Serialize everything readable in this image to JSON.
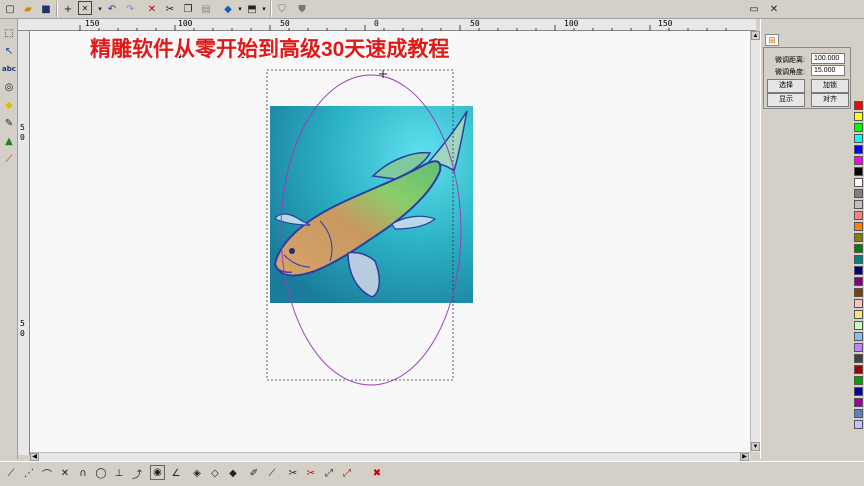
{
  "overlay_title": "精雕软件从零开始到高级30天速成教程",
  "ruler": {
    "h_labels": [
      "150",
      "100",
      "50",
      "0",
      "50",
      "100",
      "150"
    ],
    "v_labels": [
      "5",
      "0",
      "5",
      "0"
    ]
  },
  "toolbar_top": {
    "icons": [
      "new-file-icon",
      "open-folder-icon",
      "save-icon",
      "crosshair-icon",
      "snap-grid-icon",
      "undo-icon",
      "redo-icon",
      "delete-icon",
      "cut-icon",
      "copy-icon",
      "paste-icon",
      "layer-color-icon",
      "view-3d-icon",
      "display-icon",
      "shield-icon"
    ]
  },
  "left_tools": [
    "select-rect-tool-icon",
    "node-edit-tool-icon",
    "text-tool-icon",
    "transform-tool-icon",
    "fill-tool-icon",
    "pen-tool-icon",
    "tree-tool-icon",
    "measure-tool-icon"
  ],
  "right_panel": {
    "tab_icon": "grid-tab-icon",
    "fine_distance_label": "微调距离:",
    "fine_distance_value": "100.000",
    "fine_angle_label": "微调角度:",
    "fine_angle_value": "15.000",
    "btn_select": "选择",
    "btn_process": "加锁",
    "btn_display": "显示",
    "btn_align": "对齐"
  },
  "palette_colors": [
    "#ff0000",
    "#ffff00",
    "#00ff00",
    "#00ffff",
    "#0000ff",
    "#ff00ff",
    "#000000",
    "#ffffff",
    "#808080",
    "#c0c0c0",
    "#ff8080",
    "#ff8000",
    "#808000",
    "#008000",
    "#008080",
    "#000080",
    "#800080",
    "#804000",
    "#ffc0c0",
    "#ffe080",
    "#c0ffc0",
    "#80c0ff",
    "#c080ff",
    "#404040",
    "#a00000",
    "#00a000",
    "#0000a0",
    "#a000a0",
    "#6080c0",
    "#c0c0ff"
  ],
  "toolbar_bottom": {
    "icons": [
      "line-tool-icon",
      "polyline-tool-icon",
      "arc-tool-icon",
      "cross-tool-icon",
      "curve-tool-icon",
      "circle-tool-icon",
      "perpendicular-tool-icon",
      "tangent-tool-icon",
      "point-tool-icon",
      "angle-tool-icon",
      "diamond-tool-icon",
      "diamond-outline-tool-icon",
      "diamond-fill-tool-icon",
      "brush-tool-icon",
      "knife-tool-icon",
      "trim-tool-icon",
      "trim-red-tool-icon",
      "extend-tool-icon",
      "extend-red-tool-icon",
      "cancel-tool-icon"
    ]
  }
}
